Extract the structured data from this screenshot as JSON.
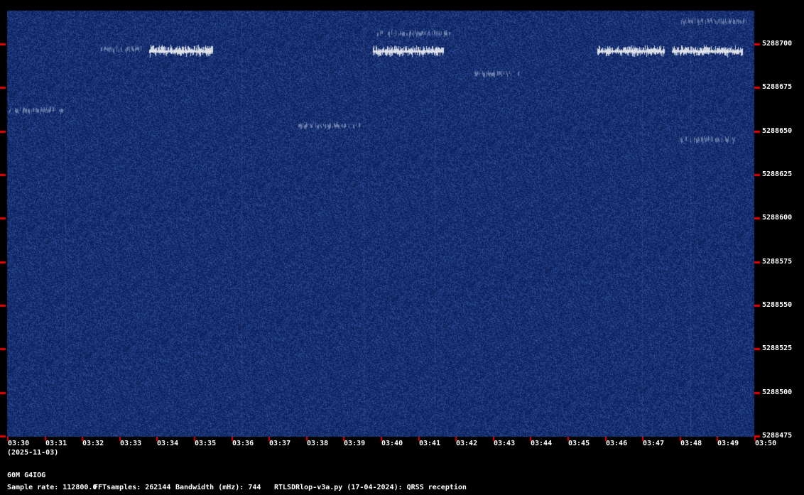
{
  "chart_data": {
    "type": "heatmap",
    "x_axis": {
      "date": "(2025-11-03)",
      "ticks": [
        "03:30",
        "03:31",
        "03:32",
        "03:33",
        "03:34",
        "03:35",
        "03:36",
        "03:37",
        "03:38",
        "03:39",
        "03:40",
        "03:41",
        "03:42",
        "03:43",
        "03:44",
        "03:45",
        "03:46",
        "03:47",
        "03:48",
        "03:49",
        "03:50"
      ]
    },
    "y_axis": {
      "ticks": [
        5288700,
        5288675,
        5288650,
        5288625,
        5288600,
        5288575,
        5288550,
        5288525,
        5288500,
        5288475
      ]
    },
    "signals": [
      {
        "minutes": [
          3.8,
          5.5
        ],
        "frequency": 5288696,
        "style": "strong"
      },
      {
        "minutes": [
          9.8,
          11.7
        ],
        "frequency": 5288696,
        "style": "strong"
      },
      {
        "minutes": [
          15.8,
          17.6
        ],
        "frequency": 5288696,
        "style": "strong"
      },
      {
        "minutes": [
          17.8,
          19.7
        ],
        "frequency": 5288696,
        "style": "strong"
      },
      {
        "minutes": [
          18.0,
          19.8
        ],
        "frequency": 5288713,
        "style": "faint"
      },
      {
        "minutes": [
          9.9,
          11.9
        ],
        "frequency": 5288706,
        "style": "faint"
      },
      {
        "minutes": [
          7.8,
          9.5
        ],
        "frequency": 5288653,
        "style": "faint"
      },
      {
        "minutes": [
          0.0,
          1.5
        ],
        "frequency": 5288662,
        "style": "faint"
      },
      {
        "minutes": [
          12.5,
          13.8
        ],
        "frequency": 5288683,
        "style": "faint"
      },
      {
        "minutes": [
          18.0,
          19.5
        ],
        "frequency": 5288645,
        "style": "faint"
      },
      {
        "minutes": [
          2.5,
          3.6
        ],
        "frequency": 5288697,
        "style": "faint"
      }
    ],
    "colors": {
      "background": "#122a6e",
      "signal": "#d8dce8",
      "tick": "#e00000"
    }
  },
  "footer": {
    "station": "60M G4IOG",
    "sample_rate": "Sample rate: 112800.0",
    "fft": "FFTsamples: 262144",
    "bandwidth": "Bandwidth (mHz): 744",
    "software": "RTLSDRlop-v3a.py (17-04-2024): QRSS reception"
  }
}
